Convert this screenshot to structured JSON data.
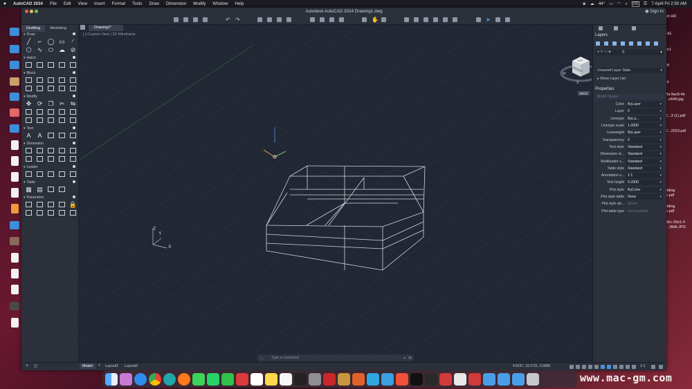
{
  "menubar": {
    "app_name": "AutoCAD 2024",
    "items": [
      "File",
      "Edit",
      "View",
      "Insert",
      "Format",
      "Tools",
      "Draw",
      "Dimension",
      "Modify",
      "Window",
      "Help"
    ],
    "temperature": "44°",
    "input_source": "US",
    "clock": "7 April Fri  2:50 AM"
  },
  "window": {
    "title": "Autodesk AutoCAD 2024   Drawing1.dwg",
    "sign_in": "Sign In"
  },
  "left_palette": {
    "tabs": [
      "Drafting",
      "Modeling"
    ],
    "active_tab": "Drafting",
    "sections": [
      {
        "name": "Draw",
        "icons": [
          "line-icon",
          "polyline-icon",
          "circle-icon",
          "rectangle-icon",
          "arc-icon",
          "polygon-icon",
          "spline-icon",
          "ellipse-icon",
          "revcloud-icon",
          "wipeout-icon"
        ]
      },
      {
        "name": "Hatch",
        "icons": [
          "hatch-icon",
          "gradient-icon",
          "boundary-icon",
          "region-icon",
          "table-small-icon"
        ]
      },
      {
        "name": "Block",
        "icons": [
          "insert-block-icon",
          "create-block-icon",
          "edit-block-icon",
          "attribute-icon",
          "sync-icon",
          "block-a-icon",
          "block-b-icon",
          "block-c-icon",
          "block-d-icon",
          "block-e-icon"
        ]
      },
      {
        "name": "Modify",
        "icons": [
          "move-icon",
          "rotate-icon",
          "copy-icon",
          "trim-icon",
          "mirror-icon",
          "scale-icon",
          "stretch-icon",
          "fillet-icon",
          "array-icon",
          "offset-icon",
          "erase-icon",
          "explode-icon",
          "join-icon",
          "break-icon",
          "chamfer-icon"
        ]
      },
      {
        "name": "Text",
        "icons": [
          "mtext-icon",
          "single-text-icon",
          "text-style-icon",
          "spell-icon",
          "find-text-icon"
        ]
      },
      {
        "name": "Dimension",
        "icons": [
          "linear-dim-icon",
          "aligned-dim-icon",
          "angular-dim-icon",
          "radius-dim-icon",
          "dim-style-icon",
          "baseline-dim-icon",
          "continue-dim-icon",
          "ordinate-dim-icon",
          "center-mark-icon",
          "tolerance-icon"
        ]
      },
      {
        "name": "Leader",
        "icons": [
          "leader-icon",
          "multileader-icon",
          "align-leader-icon",
          "collect-leader-icon",
          "leader-style-icon"
        ]
      },
      {
        "name": "Table",
        "icons": [
          "table-icon",
          "table-style-icon",
          "data-link-icon",
          "extract-icon"
        ]
      },
      {
        "name": "Parametric",
        "icons": [
          "geometric-icon",
          "dimensional-icon",
          "show-constraints-icon",
          "delete-constraints-icon",
          "lock-icon",
          "auto-constrain-icon",
          "param-a-icon",
          "param-b-icon",
          "param-c-icon",
          "param-d-icon"
        ]
      }
    ]
  },
  "canvas": {
    "doc_tab": "Drawing1*",
    "view_controls": "[-] Custom View | 2D Wireframe",
    "viewcube_face": "FRONT",
    "viewcube_top": "TOP",
    "wcs": "WCS",
    "ucs_x": "X",
    "ucs_y": "Y",
    "ucs_z": "Z"
  },
  "layers": {
    "title": "Layers",
    "current_layer": "0",
    "layer_state": "Unsaved Layer State",
    "show_list": "Show Layer List"
  },
  "properties": {
    "title": "Properties",
    "space": "Model Space",
    "rows": [
      {
        "label": "Color",
        "value": "ByLayer",
        "enabled": true
      },
      {
        "label": "Layer",
        "value": "0",
        "enabled": true
      },
      {
        "label": "Linetype",
        "value": "ByLa...",
        "enabled": true
      },
      {
        "label": "Linetype scale",
        "value": "1.0000",
        "enabled": true
      },
      {
        "label": "Lineweight",
        "value": "ByLayer",
        "enabled": true
      },
      {
        "label": "Transparency",
        "value": "0",
        "enabled": true
      },
      {
        "label": "Text style",
        "value": "Standard",
        "enabled": true
      },
      {
        "label": "Dimension st...",
        "value": "Standard",
        "enabled": true
      },
      {
        "label": "Multileader s...",
        "value": "Standard",
        "enabled": true
      },
      {
        "label": "Table style",
        "value": "Standard",
        "enabled": true
      },
      {
        "label": "Annotation s...",
        "value": "1:1",
        "enabled": true
      },
      {
        "label": "Text height",
        "value": "0.2000",
        "enabled": true
      },
      {
        "label": "Plot style",
        "value": "ByColor",
        "enabled": true
      },
      {
        "label": "Plot style table",
        "value": "None",
        "enabled": true
      },
      {
        "label": "Plot style att...",
        "value": "Model",
        "enabled": false
      },
      {
        "label": "Plot table type",
        "value": "Not available",
        "enabled": false
      }
    ]
  },
  "command_line": {
    "placeholder": "Type a command"
  },
  "status_bar": {
    "tabs": [
      "Model",
      "Layout1",
      "Layout2"
    ],
    "active_tab": "Model",
    "coordinates": "4.8157, 19.2731, 0.0000",
    "scale": "1:1"
  },
  "desktop": {
    "right_labels": [
      "sh HD",
      "HG",
      "or1",
      "rtf",
      "ut",
      "ffa-9ac8-4b",
      "...e540.jpg",
      "2...3 (1).pdf",
      "2...2023.pdf",
      "dding",
      "e.pdf",
      "dding",
      "e.pdf",
      "d6c-29e1-4",
      "...1fbfb.JPG"
    ]
  },
  "watermark": "www.mac-gm.com",
  "colors": {
    "accent": "#1e88e5",
    "canvas_bg": "#212733",
    "panel_bg": "#2b303b"
  }
}
